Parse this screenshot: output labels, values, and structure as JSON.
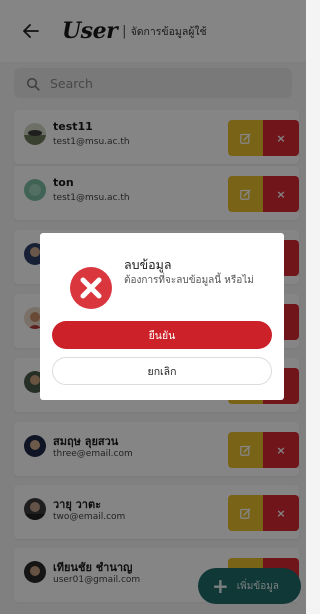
{
  "header": {
    "logo": "User",
    "separator": "|",
    "subtitle": "จัดการข้อมูลผู้ใช้"
  },
  "search": {
    "placeholder": "Search"
  },
  "users": [
    {
      "name": "test11",
      "email": "test1@msu.ac.th"
    },
    {
      "name": "ton",
      "email": "test1@msu.ac.th"
    },
    {
      "name": "",
      "email": ""
    },
    {
      "name": "",
      "email": ""
    },
    {
      "name": "",
      "email": ""
    },
    {
      "name": "สมฤษ ลุยสวน",
      "email": "three@email.com"
    },
    {
      "name": "วายุ วาตะ",
      "email": "two@email.com"
    },
    {
      "name": "เทียนชัย ชำนาญ",
      "email": "user01@gmail.com"
    }
  ],
  "actions": {
    "delete_glyph": "×"
  },
  "dialog": {
    "title": "ลบข้อมูล",
    "message": "ต้องการที่จะลบข้อมูลนี้ หรือไม่",
    "confirm_label": "ยืนยัน",
    "cancel_label": "ยกเลิก"
  },
  "fab": {
    "plus": "+",
    "label": "เพิ่มข้อมูล"
  },
  "colors": {
    "edit": "#e8bf2c",
    "delete": "#d62b35",
    "confirm": "#cc2128",
    "fab": "#1d6b6a"
  }
}
